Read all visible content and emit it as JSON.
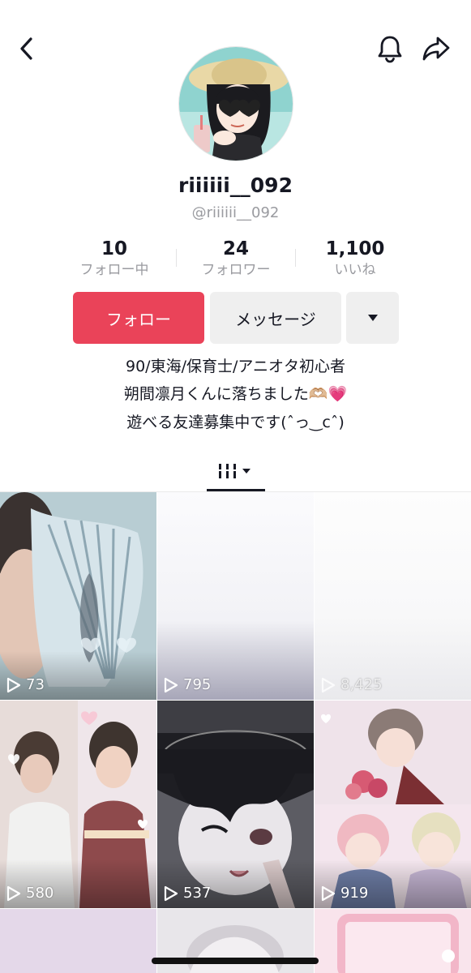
{
  "header": {
    "back_icon": "chevron-left-icon",
    "bell_icon": "bell-icon",
    "share_icon": "share-arrow-icon"
  },
  "profile": {
    "nickname": "riiiiii__092",
    "handle": "@riiiiii__092",
    "avatar_icon": "anime-girl-avatar"
  },
  "stats": [
    {
      "value": "10",
      "label": "フォロー中"
    },
    {
      "value": "24",
      "label": "フォロワー"
    },
    {
      "value": "1,100",
      "label": "いいね"
    }
  ],
  "actions": {
    "follow_label": "フォロー",
    "message_label": "メッセージ",
    "more_icon": "caret-down-icon"
  },
  "bio": {
    "line1": "90/東海/保育士/アニオタ初心者",
    "line2": "朔間凛月くんに落ちました🫶🏼💗",
    "line3": "遊べる友達募集中です(ˆ⁠っ⁠‿⁠c⁠ˆ)"
  },
  "tab": {
    "icon": "videos-grid-icon"
  },
  "videos": [
    {
      "plays": "73"
    },
    {
      "plays": "795"
    },
    {
      "plays": "8,425"
    },
    {
      "plays": "580"
    },
    {
      "plays": "537"
    },
    {
      "plays": "919"
    },
    {
      "plays": ""
    },
    {
      "plays": ""
    },
    {
      "plays": ""
    }
  ],
  "colors": {
    "follow_button": "#ea4359",
    "secondary_button": "#efefef",
    "muted_text": "#9a9ba0"
  }
}
